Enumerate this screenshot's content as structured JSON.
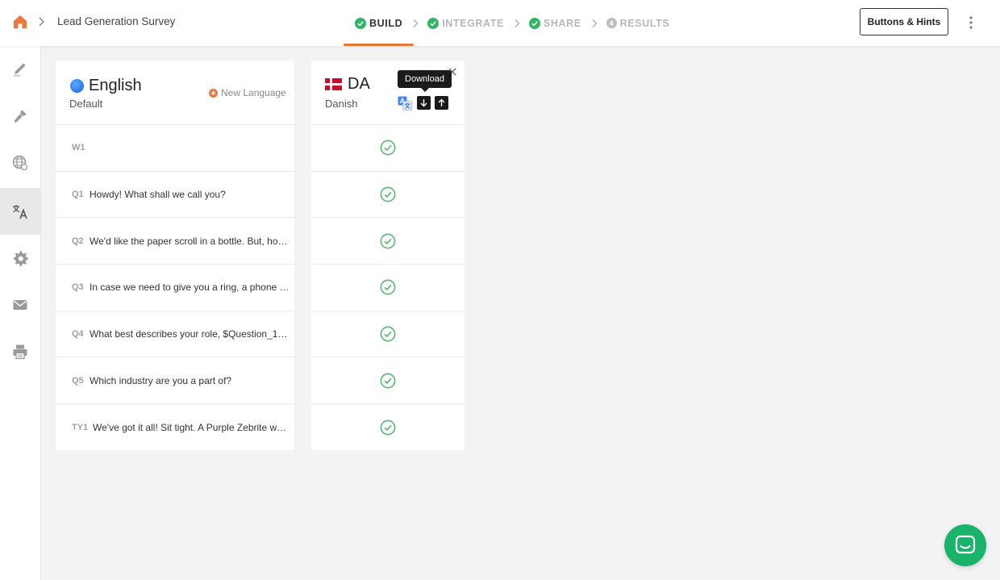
{
  "header": {
    "survey_title": "Lead Generation Survey",
    "steps": [
      {
        "label": "BUILD",
        "state": "done",
        "active": true
      },
      {
        "label": "INTEGRATE",
        "state": "done",
        "active": false
      },
      {
        "label": "SHARE",
        "state": "done",
        "active": false
      },
      {
        "label": "RESULTS",
        "number": "4",
        "active": false
      }
    ],
    "hints_button": "Buttons & Hints"
  },
  "sidebar": {
    "items": [
      {
        "icon": "pen-icon"
      },
      {
        "icon": "paint-brush-icon"
      },
      {
        "icon": "globe-icon"
      },
      {
        "icon": "translate-icon",
        "active": true
      },
      {
        "icon": "gear-icon"
      },
      {
        "icon": "envelope-icon"
      },
      {
        "icon": "printer-icon"
      }
    ]
  },
  "default_language": {
    "name": "English",
    "sub": "Default",
    "new_language_label": "New Language"
  },
  "translation_language": {
    "code": "DA",
    "name": "Danish",
    "tooltip": "Download"
  },
  "questions": [
    {
      "id": "W1",
      "text": ""
    },
    {
      "id": "Q1",
      "text": "Howdy! What shall we call you?"
    },
    {
      "id": "Q2",
      "text": "We'd like the paper scroll in a bottle. But, ho…"
    },
    {
      "id": "Q3",
      "text": "In case we need to give you a ring, a phone …"
    },
    {
      "id": "Q4",
      "text": "What best describes your role, $Question_1…"
    },
    {
      "id": "Q5",
      "text": "Which industry are you a part of?"
    },
    {
      "id": "TY1",
      "text": "We've got it all! Sit tight. A Purple Zebrite w…"
    }
  ],
  "colors": {
    "accent": "#e8793a",
    "success": "#2fb563",
    "chat": "#19b46a",
    "check": "#62b97a"
  }
}
